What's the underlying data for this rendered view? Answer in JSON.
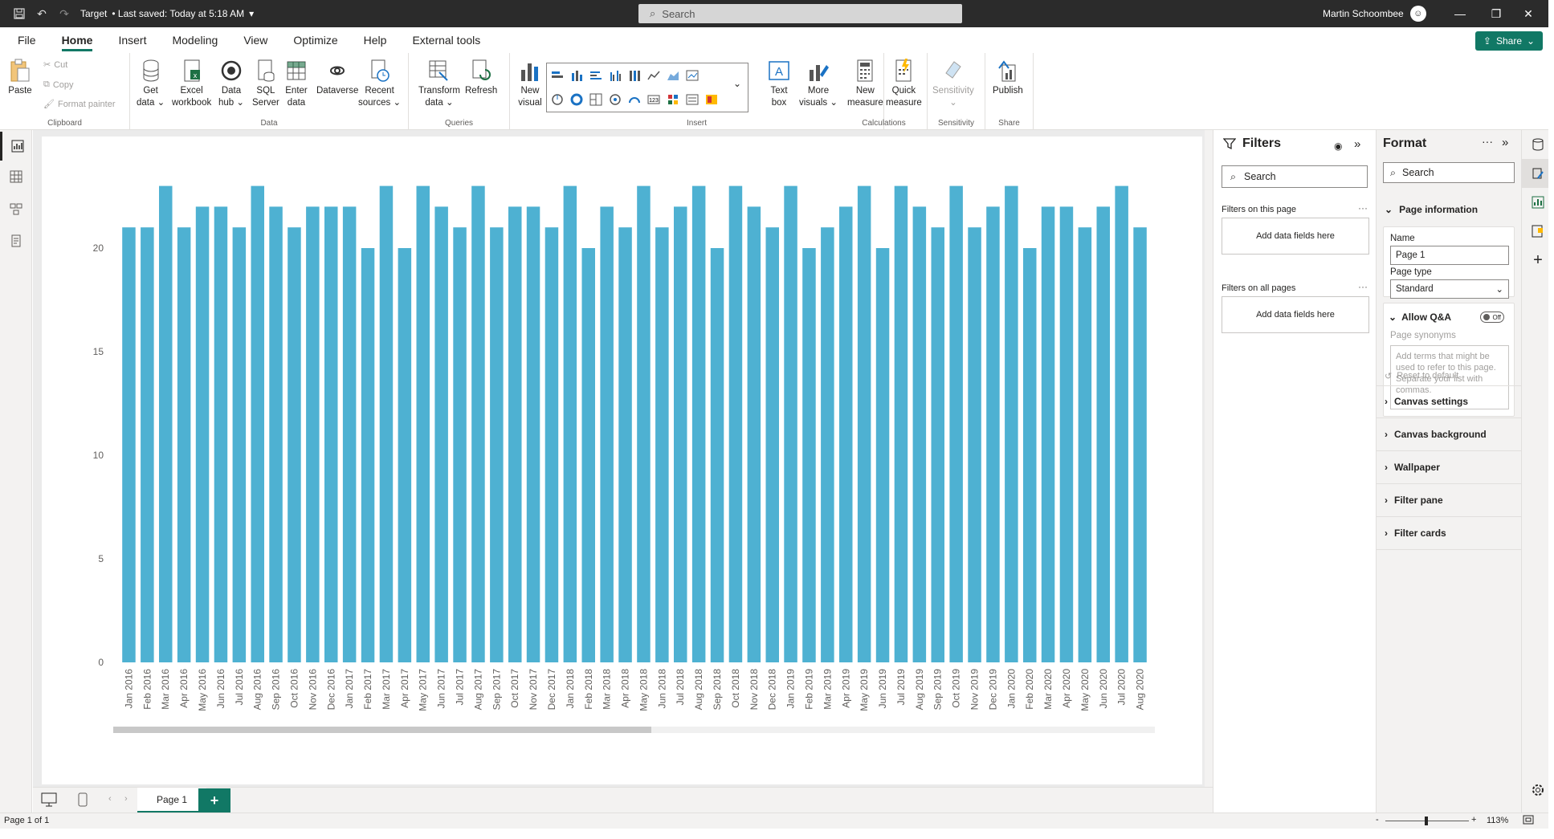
{
  "titlebar": {
    "file_name": "Target",
    "saved_status": "• Last saved: Today at 5:18 AM",
    "search_placeholder": "Search",
    "user_name": "Martin Schoombee"
  },
  "menu": {
    "items": [
      "File",
      "Home",
      "Insert",
      "Modeling",
      "View",
      "Optimize",
      "Help",
      "External tools"
    ],
    "active": "Home",
    "share_label": "Share"
  },
  "ribbon": {
    "clipboard": {
      "paste": "Paste",
      "cut": "Cut",
      "copy": "Copy",
      "format_painter": "Format painter",
      "label": "Clipboard"
    },
    "data": {
      "get_data": [
        "Get",
        "data ⌄"
      ],
      "excel": [
        "Excel",
        "workbook"
      ],
      "data_hub": [
        "Data",
        "hub ⌄"
      ],
      "sql": [
        "SQL",
        "Server"
      ],
      "enter": [
        "Enter",
        "data"
      ],
      "dataverse": [
        "Dataverse"
      ],
      "recent": [
        "Recent",
        "sources ⌄"
      ],
      "label": "Data"
    },
    "queries": {
      "transform": [
        "Transform",
        "data ⌄"
      ],
      "refresh": [
        "Refresh"
      ],
      "label": "Queries"
    },
    "insert": {
      "new_visual": [
        "New",
        "visual"
      ],
      "text_box": [
        "Text",
        "box"
      ],
      "more_visuals": [
        "More",
        "visuals ⌄"
      ],
      "label": "Insert"
    },
    "calculations": {
      "new_measure": [
        "New",
        "measure"
      ],
      "quick_measure": [
        "Quick",
        "measure"
      ],
      "label": "Calculations"
    },
    "sensitivity": {
      "sensitivity": [
        "Sensitivity",
        "⌄"
      ],
      "label": "Sensitivity"
    },
    "share": {
      "publish": [
        "Publish"
      ],
      "label": "Share"
    }
  },
  "chart_data": {
    "type": "bar",
    "categories": [
      "Jan 2016",
      "Feb 2016",
      "Mar 2016",
      "Apr 2016",
      "May 2016",
      "Jun 2016",
      "Jul 2016",
      "Aug 2016",
      "Sep 2016",
      "Oct 2016",
      "Nov 2016",
      "Dec 2016",
      "Jan 2017",
      "Feb 2017",
      "Mar 2017",
      "Apr 2017",
      "May 2017",
      "Jun 2017",
      "Jul 2017",
      "Aug 2017",
      "Sep 2017",
      "Oct 2017",
      "Nov 2017",
      "Dec 2017",
      "Jan 2018",
      "Feb 2018",
      "Mar 2018",
      "Apr 2018",
      "May 2018",
      "Jun 2018",
      "Jul 2018",
      "Aug 2018",
      "Sep 2018",
      "Oct 2018",
      "Nov 2018",
      "Dec 2018",
      "Jan 2019",
      "Feb 2019",
      "Mar 2019",
      "Apr 2019",
      "May 2019",
      "Jun 2019",
      "Jul 2019",
      "Aug 2019",
      "Sep 2019",
      "Oct 2019",
      "Nov 2019",
      "Dec 2019",
      "Jan 2020",
      "Feb 2020",
      "Mar 2020",
      "Apr 2020",
      "May 2020",
      "Jun 2020",
      "Jul 2020",
      "Aug 2020"
    ],
    "values": [
      21,
      21,
      23,
      21,
      22,
      22,
      21,
      23,
      22,
      21,
      22,
      22,
      22,
      20,
      23,
      20,
      23,
      22,
      21,
      23,
      21,
      22,
      22,
      21,
      23,
      20,
      22,
      21,
      23,
      21,
      22,
      23,
      20,
      23,
      22,
      21,
      23,
      20,
      21,
      22,
      23,
      20,
      23,
      22,
      21,
      23,
      21,
      22,
      23,
      20,
      22,
      22,
      21,
      22,
      23,
      21
    ],
    "yticks": [
      "0",
      "5",
      "10",
      "15",
      "20"
    ],
    "ylim": [
      0,
      23
    ],
    "color": "#4eb1d2",
    "grid": false
  },
  "pages": {
    "tabs": [
      "Page 1"
    ],
    "add_label": "+"
  },
  "statusbar": {
    "page_info": "Page 1 of 1",
    "zoom": "113%",
    "zoom_minus": "-",
    "zoom_plus": "+"
  },
  "filters": {
    "title": "Filters",
    "search_placeholder": "Search",
    "on_this_page": "Filters on this page",
    "on_all_pages": "Filters on all pages",
    "add_fields": "Add data fields here",
    "dots": "···"
  },
  "format": {
    "title": "Format",
    "search_placeholder": "Search",
    "page_info": "Page information",
    "name_label": "Name",
    "name_value": "Page 1",
    "page_type_label": "Page type",
    "page_type_value": "Standard",
    "allow_qa": "Allow Q&A",
    "toggle_state": "Off",
    "page_synonyms": "Page synonyms",
    "synonyms_placeholder": "Add terms that might be used to refer to this page. Separate your list with commas.",
    "reset": "Reset to default",
    "sections": [
      "Canvas settings",
      "Canvas background",
      "Wallpaper",
      "Filter pane",
      "Filter cards"
    ]
  },
  "colors": {
    "accent": "#117865",
    "bar": "#4eb1d2",
    "titlebar": "#2b2b2b"
  }
}
